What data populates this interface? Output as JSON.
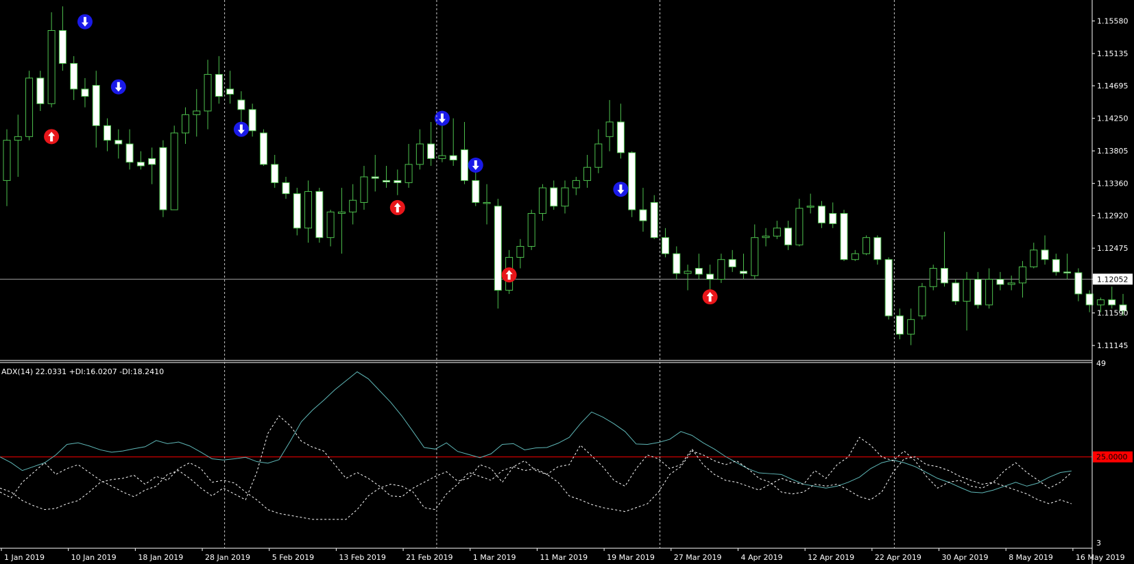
{
  "chart_data": {
    "type": "candlestick",
    "main_panel": {
      "y_ticks": [
        "1.15580",
        "1.15135",
        "1.14695",
        "1.14250",
        "1.13805",
        "1.13360",
        "1.12920",
        "1.12475",
        "1.12052",
        "1.11590",
        "1.11145"
      ],
      "current_price": 1.12052,
      "current_price_label": "1.12052",
      "ylim": [
        1.1095,
        1.1582
      ],
      "candles": [
        {
          "o": 1.134,
          "h": 1.141,
          "l": 1.1305,
          "c": 1.1395
        },
        {
          "o": 1.1395,
          "h": 1.143,
          "l": 1.1345,
          "c": 1.14
        },
        {
          "o": 1.14,
          "h": 1.149,
          "l": 1.1395,
          "c": 1.148
        },
        {
          "o": 1.148,
          "h": 1.149,
          "l": 1.1435,
          "c": 1.1445
        },
        {
          "o": 1.1445,
          "h": 1.157,
          "l": 1.144,
          "c": 1.1545
        },
        {
          "o": 1.1545,
          "h": 1.1578,
          "l": 1.149,
          "c": 1.15
        },
        {
          "o": 1.15,
          "h": 1.151,
          "l": 1.145,
          "c": 1.1465
        },
        {
          "o": 1.1465,
          "h": 1.148,
          "l": 1.144,
          "c": 1.1455
        },
        {
          "o": 1.147,
          "h": 1.149,
          "l": 1.1385,
          "c": 1.1415
        },
        {
          "o": 1.1415,
          "h": 1.1425,
          "l": 1.138,
          "c": 1.1395
        },
        {
          "o": 1.1395,
          "h": 1.141,
          "l": 1.137,
          "c": 1.139
        },
        {
          "o": 1.139,
          "h": 1.141,
          "l": 1.1355,
          "c": 1.1365
        },
        {
          "o": 1.1365,
          "h": 1.138,
          "l": 1.1355,
          "c": 1.136
        },
        {
          "o": 1.137,
          "h": 1.1385,
          "l": 1.1335,
          "c": 1.1362
        },
        {
          "o": 1.1385,
          "h": 1.1395,
          "l": 1.129,
          "c": 1.13
        },
        {
          "o": 1.13,
          "h": 1.1415,
          "l": 1.13,
          "c": 1.1405
        },
        {
          "o": 1.1405,
          "h": 1.144,
          "l": 1.139,
          "c": 1.143
        },
        {
          "o": 1.143,
          "h": 1.1465,
          "l": 1.14,
          "c": 1.1435
        },
        {
          "o": 1.1435,
          "h": 1.1505,
          "l": 1.141,
          "c": 1.1485
        },
        {
          "o": 1.1485,
          "h": 1.151,
          "l": 1.1445,
          "c": 1.1455
        },
        {
          "o": 1.1465,
          "h": 1.149,
          "l": 1.1445,
          "c": 1.1458
        },
        {
          "o": 1.145,
          "h": 1.1462,
          "l": 1.142,
          "c": 1.1437
        },
        {
          "o": 1.1437,
          "h": 1.1445,
          "l": 1.14,
          "c": 1.1408
        },
        {
          "o": 1.1405,
          "h": 1.141,
          "l": 1.136,
          "c": 1.1362
        },
        {
          "o": 1.1362,
          "h": 1.1375,
          "l": 1.133,
          "c": 1.1337
        },
        {
          "o": 1.1337,
          "h": 1.1345,
          "l": 1.1315,
          "c": 1.1322
        },
        {
          "o": 1.1322,
          "h": 1.133,
          "l": 1.1265,
          "c": 1.1275
        },
        {
          "o": 1.1275,
          "h": 1.134,
          "l": 1.1255,
          "c": 1.1325
        },
        {
          "o": 1.1325,
          "h": 1.133,
          "l": 1.1255,
          "c": 1.1262
        },
        {
          "o": 1.1262,
          "h": 1.13,
          "l": 1.125,
          "c": 1.1297
        },
        {
          "o": 1.1295,
          "h": 1.133,
          "l": 1.124,
          "c": 1.1297
        },
        {
          "o": 1.1297,
          "h": 1.1335,
          "l": 1.128,
          "c": 1.1313
        },
        {
          "o": 1.131,
          "h": 1.136,
          "l": 1.13,
          "c": 1.1345
        },
        {
          "o": 1.1345,
          "h": 1.1375,
          "l": 1.1325,
          "c": 1.1343
        },
        {
          "o": 1.134,
          "h": 1.136,
          "l": 1.133,
          "c": 1.1338
        },
        {
          "o": 1.134,
          "h": 1.1355,
          "l": 1.132,
          "c": 1.1337
        },
        {
          "o": 1.1337,
          "h": 1.139,
          "l": 1.133,
          "c": 1.1362
        },
        {
          "o": 1.1362,
          "h": 1.141,
          "l": 1.1355,
          "c": 1.139
        },
        {
          "o": 1.139,
          "h": 1.142,
          "l": 1.136,
          "c": 1.137
        },
        {
          "o": 1.137,
          "h": 1.1425,
          "l": 1.1365,
          "c": 1.1374
        },
        {
          "o": 1.1374,
          "h": 1.1425,
          "l": 1.136,
          "c": 1.1368
        },
        {
          "o": 1.1382,
          "h": 1.142,
          "l": 1.1335,
          "c": 1.134
        },
        {
          "o": 1.134,
          "h": 1.136,
          "l": 1.1305,
          "c": 1.131
        },
        {
          "o": 1.131,
          "h": 1.1335,
          "l": 1.128,
          "c": 1.131
        },
        {
          "o": 1.1305,
          "h": 1.1315,
          "l": 1.1165,
          "c": 1.119
        },
        {
          "o": 1.119,
          "h": 1.1245,
          "l": 1.1185,
          "c": 1.1235
        },
        {
          "o": 1.1235,
          "h": 1.126,
          "l": 1.122,
          "c": 1.125
        },
        {
          "o": 1.125,
          "h": 1.13,
          "l": 1.1245,
          "c": 1.1295
        },
        {
          "o": 1.1295,
          "h": 1.1335,
          "l": 1.1285,
          "c": 1.133
        },
        {
          "o": 1.133,
          "h": 1.134,
          "l": 1.13,
          "c": 1.1305
        },
        {
          "o": 1.1305,
          "h": 1.134,
          "l": 1.1295,
          "c": 1.133
        },
        {
          "o": 1.133,
          "h": 1.1345,
          "l": 1.132,
          "c": 1.134
        },
        {
          "o": 1.134,
          "h": 1.1375,
          "l": 1.133,
          "c": 1.1358
        },
        {
          "o": 1.1358,
          "h": 1.141,
          "l": 1.135,
          "c": 1.139
        },
        {
          "o": 1.14,
          "h": 1.145,
          "l": 1.138,
          "c": 1.142
        },
        {
          "o": 1.142,
          "h": 1.1445,
          "l": 1.137,
          "c": 1.1378
        },
        {
          "o": 1.1378,
          "h": 1.138,
          "l": 1.129,
          "c": 1.13
        },
        {
          "o": 1.13,
          "h": 1.133,
          "l": 1.127,
          "c": 1.1285
        },
        {
          "o": 1.131,
          "h": 1.132,
          "l": 1.126,
          "c": 1.1262
        },
        {
          "o": 1.1262,
          "h": 1.1275,
          "l": 1.1235,
          "c": 1.124
        },
        {
          "o": 1.124,
          "h": 1.125,
          "l": 1.1205,
          "c": 1.1213
        },
        {
          "o": 1.1213,
          "h": 1.1225,
          "l": 1.119,
          "c": 1.1216
        },
        {
          "o": 1.122,
          "h": 1.124,
          "l": 1.1205,
          "c": 1.1212
        },
        {
          "o": 1.1212,
          "h": 1.1225,
          "l": 1.1185,
          "c": 1.1205
        },
        {
          "o": 1.1205,
          "h": 1.124,
          "l": 1.12,
          "c": 1.1232
        },
        {
          "o": 1.1232,
          "h": 1.1245,
          "l": 1.1215,
          "c": 1.1222
        },
        {
          "o": 1.1216,
          "h": 1.124,
          "l": 1.1205,
          "c": 1.1213
        },
        {
          "o": 1.121,
          "h": 1.128,
          "l": 1.1205,
          "c": 1.1262
        },
        {
          "o": 1.1262,
          "h": 1.1275,
          "l": 1.125,
          "c": 1.1264
        },
        {
          "o": 1.1264,
          "h": 1.1285,
          "l": 1.126,
          "c": 1.1275
        },
        {
          "o": 1.1275,
          "h": 1.1285,
          "l": 1.1245,
          "c": 1.1252
        },
        {
          "o": 1.1252,
          "h": 1.1315,
          "l": 1.125,
          "c": 1.1302
        },
        {
          "o": 1.1305,
          "h": 1.1322,
          "l": 1.1295,
          "c": 1.1305
        },
        {
          "o": 1.1305,
          "h": 1.1312,
          "l": 1.1275,
          "c": 1.1282
        },
        {
          "o": 1.1295,
          "h": 1.131,
          "l": 1.1275,
          "c": 1.1281
        },
        {
          "o": 1.1295,
          "h": 1.13,
          "l": 1.123,
          "c": 1.1232
        },
        {
          "o": 1.1232,
          "h": 1.1245,
          "l": 1.123,
          "c": 1.124
        },
        {
          "o": 1.124,
          "h": 1.1265,
          "l": 1.1238,
          "c": 1.1262
        },
        {
          "o": 1.1262,
          "h": 1.1265,
          "l": 1.1225,
          "c": 1.1232
        },
        {
          "o": 1.1232,
          "h": 1.1235,
          "l": 1.115,
          "c": 1.1155
        },
        {
          "o": 1.1155,
          "h": 1.1165,
          "l": 1.1123,
          "c": 1.113
        },
        {
          "o": 1.113,
          "h": 1.1165,
          "l": 1.1115,
          "c": 1.115
        },
        {
          "o": 1.1155,
          "h": 1.12,
          "l": 1.115,
          "c": 1.1195
        },
        {
          "o": 1.1195,
          "h": 1.1225,
          "l": 1.119,
          "c": 1.122
        },
        {
          "o": 1.122,
          "h": 1.127,
          "l": 1.1195,
          "c": 1.12
        },
        {
          "o": 1.12,
          "h": 1.1205,
          "l": 1.117,
          "c": 1.1175
        },
        {
          "o": 1.1175,
          "h": 1.1215,
          "l": 1.1135,
          "c": 1.1205
        },
        {
          "o": 1.1205,
          "h": 1.1215,
          "l": 1.1165,
          "c": 1.117
        },
        {
          "o": 1.117,
          "h": 1.122,
          "l": 1.1165,
          "c": 1.1205
        },
        {
          "o": 1.1205,
          "h": 1.1215,
          "l": 1.119,
          "c": 1.1198
        },
        {
          "o": 1.1198,
          "h": 1.121,
          "l": 1.119,
          "c": 1.12
        },
        {
          "o": 1.12,
          "h": 1.123,
          "l": 1.118,
          "c": 1.1222
        },
        {
          "o": 1.1222,
          "h": 1.1255,
          "l": 1.122,
          "c": 1.1245
        },
        {
          "o": 1.1245,
          "h": 1.1265,
          "l": 1.1225,
          "c": 1.1232
        },
        {
          "o": 1.1232,
          "h": 1.124,
          "l": 1.121,
          "c": 1.1215
        },
        {
          "o": 1.1215,
          "h": 1.124,
          "l": 1.1205,
          "c": 1.1214
        },
        {
          "o": 1.1214,
          "h": 1.122,
          "l": 1.1175,
          "c": 1.1185
        },
        {
          "o": 1.1185,
          "h": 1.119,
          "l": 1.116,
          "c": 1.117
        },
        {
          "o": 1.117,
          "h": 1.118,
          "l": 1.116,
          "c": 1.1177
        },
        {
          "o": 1.1177,
          "h": 1.1195,
          "l": 1.1165,
          "c": 1.117
        },
        {
          "o": 1.117,
          "h": 1.1185,
          "l": 1.1155,
          "c": 1.1162
        }
      ],
      "arrows": [
        {
          "i": 4,
          "price": 1.14,
          "dir": "up"
        },
        {
          "i": 7,
          "price": 1.1557,
          "dir": "down"
        },
        {
          "i": 10,
          "price": 1.1468,
          "dir": "down"
        },
        {
          "i": 21,
          "price": 1.141,
          "dir": "down"
        },
        {
          "i": 35,
          "price": 1.1303,
          "dir": "up"
        },
        {
          "i": 39,
          "price": 1.1425,
          "dir": "down"
        },
        {
          "i": 42,
          "price": 1.1361,
          "dir": "down"
        },
        {
          "i": 45,
          "price": 1.1211,
          "dir": "up"
        },
        {
          "i": 55,
          "price": 1.1328,
          "dir": "down"
        },
        {
          "i": 63,
          "price": 1.1181,
          "dir": "up"
        }
      ],
      "date_separators": [
        20,
        39,
        59,
        80
      ]
    },
    "indicator_panel": {
      "label": "ADX(14) 22.0331 +DI:16.0207 -DI:18.2410",
      "ylim": [
        3,
        49
      ],
      "y_max_label": "49",
      "y_min_label": "3",
      "level": 25.0,
      "level_label": "25.0000",
      "series": [
        {
          "name": "ADX",
          "style": "solid",
          "color": "#5fb8b8",
          "values": [
            25,
            23.5,
            21.5,
            22.5,
            23.5,
            25.5,
            28.2,
            28.6,
            27.8,
            26.8,
            26.2,
            26.5,
            27.1,
            27.6,
            29.2,
            28.4,
            28.8,
            27.8,
            26.2,
            24.5,
            24.2,
            24.5,
            24.9,
            23.8,
            23.4,
            24.3,
            29,
            34,
            37,
            39.5,
            42.2,
            44.5,
            46.8,
            45,
            42,
            39,
            35.5,
            31.5,
            27.4,
            27,
            28.6,
            26.4,
            25.6,
            24.8,
            25.8,
            28.2,
            28.4,
            26.8,
            27.3,
            27.4,
            28.5,
            30,
            33.5,
            36.5,
            35.2,
            33.5,
            31.5,
            28.3,
            28.2,
            28.7,
            29.5,
            31.5,
            30.5,
            28.6,
            27,
            25.1,
            23.5,
            22,
            20.9,
            20.7,
            20.5,
            19.2,
            18,
            17.5,
            17,
            17.5,
            18.5,
            19.8,
            22,
            23.5,
            24.2,
            23.5,
            22.5,
            21,
            19.5,
            18.5,
            17.2,
            16,
            15.8,
            16.5,
            17.5,
            18.5,
            17.5,
            18.3,
            19.8,
            21,
            21.4
          ]
        },
        {
          "name": "+DI",
          "style": "dash",
          "color": "#ffffff",
          "values": [
            16,
            14.5,
            18.5,
            21,
            23.5,
            20.5,
            22,
            23,
            21,
            19,
            17.5,
            16,
            14.8,
            16.5,
            17.5,
            20.5,
            21.5,
            19.5,
            17,
            15,
            17,
            15.5,
            14,
            21,
            31,
            35.5,
            33,
            29,
            27.5,
            26.5,
            23,
            19.5,
            21,
            19.5,
            17.5,
            15,
            14.8,
            17,
            18.5,
            20,
            21.2,
            18.8,
            19.5,
            23,
            22,
            18.5,
            22.5,
            24,
            21.5,
            20.5,
            22.5,
            23,
            28,
            25.3,
            22.5,
            19,
            17.5,
            22,
            25.5,
            24.5,
            22,
            23,
            27,
            23,
            20.5,
            19,
            18.5,
            17.5,
            16.5,
            18,
            19.5,
            18.5,
            18,
            21.5,
            19.5,
            23,
            25,
            30,
            28,
            25,
            24,
            26.5,
            24,
            20,
            17,
            18.5,
            19,
            17.5,
            17,
            18.5,
            21.5,
            23.5,
            21,
            19,
            17,
            18.5,
            21
          ]
        },
        {
          "name": "-DI",
          "style": "dash",
          "color": "#ffffff",
          "values": [
            17,
            16,
            13.8,
            12.5,
            11.5,
            11.8,
            13,
            13.8,
            16,
            18.5,
            19.2,
            19.5,
            20.3,
            18,
            20,
            19,
            22,
            23.5,
            22,
            18.5,
            19,
            18.3,
            16,
            14,
            11.5,
            10.5,
            10,
            9.5,
            9,
            9,
            9,
            9,
            11.5,
            15,
            17,
            18,
            17.5,
            16,
            12,
            11.5,
            15.5,
            18,
            21,
            20,
            19,
            21.5,
            22.5,
            21.5,
            22,
            20.5,
            18.5,
            15,
            14,
            12.8,
            12,
            11.5,
            11,
            12,
            13,
            16,
            20.5,
            22.5,
            26.5,
            25.5,
            24,
            23,
            24,
            22,
            19.5,
            18.5,
            16,
            15.5,
            16,
            18,
            17.5,
            18,
            16.5,
            14.8,
            14,
            16,
            21,
            24.5,
            25,
            23,
            22.5,
            21.5,
            20,
            19,
            18,
            18.5,
            17.5,
            16.5,
            15.5,
            14,
            13,
            14,
            13
          ]
        }
      ]
    },
    "x_tick_labels": [
      {
        "i": 0,
        "label": "1 Jan 2019"
      },
      {
        "i": 6,
        "label": "10 Jan 2019"
      },
      {
        "i": 12,
        "label": "18 Jan 2019"
      },
      {
        "i": 18,
        "label": "28 Jan 2019"
      },
      {
        "i": 24,
        "label": "5 Feb 2019"
      },
      {
        "i": 30,
        "label": "13 Feb 2019"
      },
      {
        "i": 36,
        "label": "21 Feb 2019"
      },
      {
        "i": 42,
        "label": "1 Mar 2019"
      },
      {
        "i": 48,
        "label": "11 Mar 2019"
      },
      {
        "i": 54,
        "label": "19 Mar 2019"
      },
      {
        "i": 60,
        "label": "27 Mar 2019"
      },
      {
        "i": 66,
        "label": "4 Apr 2019"
      },
      {
        "i": 72,
        "label": "12 Apr 2019"
      },
      {
        "i": 78,
        "label": "22 Apr 2019"
      },
      {
        "i": 84,
        "label": "30 Apr 2019"
      },
      {
        "i": 90,
        "label": "8 May 2019"
      },
      {
        "i": 96,
        "label": "16 May 2019"
      }
    ],
    "colors": {
      "background": "#000000",
      "bull_body": "#000000",
      "bear_body": "#ffffff",
      "candle_outline": "#4ec24e",
      "wick": "#4ec24e",
      "buy_arrow": "#e8161a",
      "sell_arrow": "#1a1ae8",
      "level_line": "#ff0000",
      "price_line": "#a0a0a0",
      "axis_text": "#ffffff",
      "grid_separator": "#c8c8c8"
    }
  }
}
